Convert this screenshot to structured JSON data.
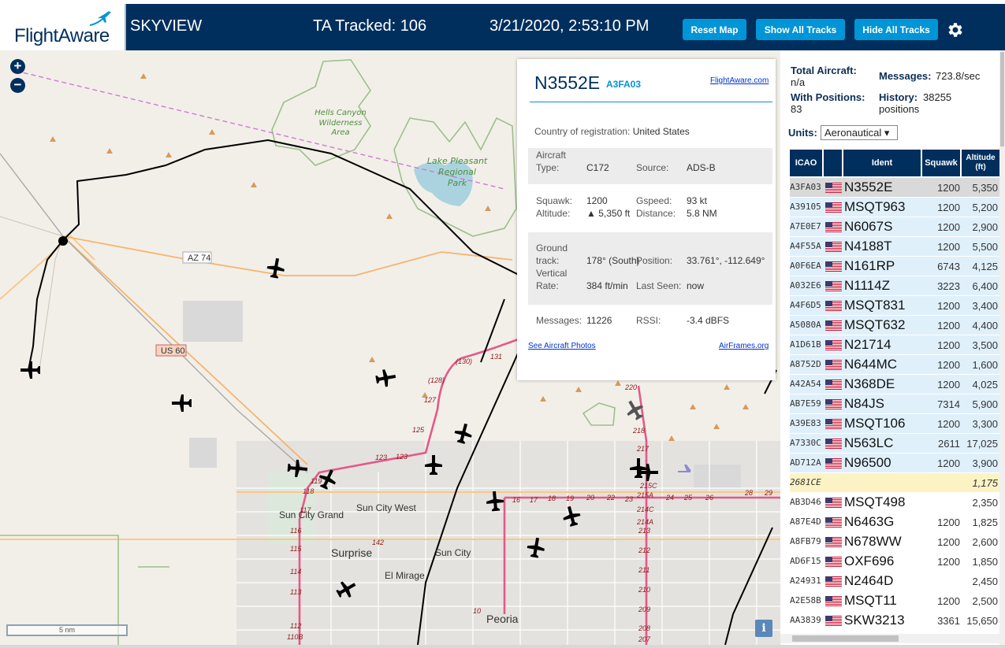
{
  "header": {
    "logo": "FlightAware",
    "title": "SKYVIEW",
    "tracked": "TA Tracked: 106",
    "datetime": "3/21/2020, 2:53:10 PM",
    "buttons": {
      "reset": "Reset Map",
      "show": "Show All Tracks",
      "hide": "Hide All Tracks"
    },
    "settings_icon": "gear-icon"
  },
  "map": {
    "zoom_in": "+",
    "zoom_out": "−",
    "scale": "5 nm",
    "info": "i",
    "labels": {
      "hells_canyon": [
        "Hells Canyon",
        "Wilderness",
        "Area"
      ],
      "lake_pleasant": [
        "Lake Pleasant",
        "Regional",
        "Park"
      ],
      "az74": "AZ 74",
      "us60": "US 60",
      "sun_city_west": "Sun City West",
      "sun_city_grand": "Sun City Grand",
      "sun_city": "Sun City",
      "surprise": "Surprise",
      "el_mirage": "El Mirage",
      "peoria": "Peoria"
    },
    "exit_numbers": [
      "(130)",
      "131",
      "(128)",
      "127",
      "125",
      "123",
      "123",
      "119",
      "118",
      "117",
      "116",
      "115",
      "114",
      "113",
      "112",
      "110B",
      "142",
      "220",
      "218",
      "217",
      "215C",
      "215A",
      "214C",
      "214A",
      "213",
      "212",
      "211",
      "210",
      "209",
      "208",
      "207",
      "16",
      "17",
      "18",
      "19",
      "20",
      "22",
      "23",
      "24",
      "25",
      "26",
      "28",
      "29",
      "10"
    ]
  },
  "detail": {
    "ident": "N3552E",
    "icao": "A3FA03",
    "fa_link": "FlightAware.com",
    "country_label": "Country of registration:",
    "country": "United States",
    "aircraft_type_label": [
      "Aircraft",
      "Type:"
    ],
    "aircraft_type": "C172",
    "source_label": "Source:",
    "source": "ADS-B",
    "squawk_label": "Squawk:",
    "squawk": "1200",
    "gspeed_label": "Gspeed:",
    "gspeed": "93 kt",
    "altitude_label": "Altitude:",
    "altitude": "▲ 5,350 ft",
    "distance_label": "Distance:",
    "distance": "5.8 NM",
    "ground_track_label": [
      "Ground",
      "track:"
    ],
    "ground_track": "178° (South)",
    "position_label": "Position:",
    "position": "33.761°, -112.649°",
    "vrate_label": [
      "Vertical",
      "Rate:"
    ],
    "vrate": "384 ft/min",
    "last_seen_label": "Last Seen:",
    "last_seen": "now",
    "messages_label": "Messages:",
    "messages": "11226",
    "rssi_label": "RSSI:",
    "rssi": "-3.4 dBFS",
    "photos_link": "See Aircraft Photos",
    "airframes_link": "AirFrames.org"
  },
  "sidebar": {
    "total_label": "Total Aircraft:",
    "total": "n/a",
    "messages_label": "Messages:",
    "messages": "723.8/sec",
    "positions_label": "With Positions:",
    "positions": "83",
    "history_label": "History:",
    "history": "38255",
    "history_unit": "positions",
    "units_label": "Units:",
    "units_value": "Aeronautical ▾",
    "columns": {
      "icao": "ICAO",
      "ident": "Ident",
      "squawk": "Squawk",
      "altitude": [
        "Altitude",
        "(ft)"
      ]
    },
    "rows": [
      {
        "icao": "A3FA03",
        "flag": true,
        "ident": "N3552E",
        "squawk": "1200",
        "altitude": "5,350",
        "style": "sel"
      },
      {
        "icao": "A39105",
        "flag": true,
        "ident": "MSQT963",
        "squawk": "1200",
        "altitude": "5,200",
        "style": "blue"
      },
      {
        "icao": "A7E0E7",
        "flag": true,
        "ident": "N6067S",
        "squawk": "1200",
        "altitude": "2,900",
        "style": "blue"
      },
      {
        "icao": "A4F55A",
        "flag": true,
        "ident": "N4188T",
        "squawk": "1200",
        "altitude": "5,500",
        "style": "blue"
      },
      {
        "icao": "A0F6EA",
        "flag": true,
        "ident": "N161RP",
        "squawk": "6743",
        "altitude": "4,125",
        "style": "blue"
      },
      {
        "icao": "A032E6",
        "flag": true,
        "ident": "N1114Z",
        "squawk": "3223",
        "altitude": "6,400",
        "style": "blue"
      },
      {
        "icao": "A4F6D5",
        "flag": true,
        "ident": "MSQT831",
        "squawk": "1200",
        "altitude": "3,400",
        "style": "blue"
      },
      {
        "icao": "A5080A",
        "flag": true,
        "ident": "MSQT632",
        "squawk": "1200",
        "altitude": "4,400",
        "style": "blue"
      },
      {
        "icao": "A1D61B",
        "flag": true,
        "ident": "N21714",
        "squawk": "1200",
        "altitude": "3,500",
        "style": "blue"
      },
      {
        "icao": "A8752D",
        "flag": true,
        "ident": "N644MC",
        "squawk": "1200",
        "altitude": "1,600",
        "style": "blue"
      },
      {
        "icao": "A42A54",
        "flag": true,
        "ident": "N368DE",
        "squawk": "1200",
        "altitude": "4,025",
        "style": "blue"
      },
      {
        "icao": "AB7E59",
        "flag": true,
        "ident": "N84JS",
        "squawk": "7314",
        "altitude": "5,900",
        "style": "blue"
      },
      {
        "icao": "A39E83",
        "flag": true,
        "ident": "MSQT106",
        "squawk": "1200",
        "altitude": "3,300",
        "style": "blue"
      },
      {
        "icao": "A7330C",
        "flag": true,
        "ident": "N563LC",
        "squawk": "2611",
        "altitude": "17,025",
        "style": "blue"
      },
      {
        "icao": "AD712A",
        "flag": true,
        "ident": "N96500",
        "squawk": "1200",
        "altitude": "3,900",
        "style": "blue"
      },
      {
        "icao": "2681CE",
        "flag": false,
        "ident": "",
        "squawk": "",
        "altitude": "1,175",
        "style": "yellow"
      },
      {
        "icao": "AB3D46",
        "flag": true,
        "ident": "MSQT498",
        "squawk": "",
        "altitude": "2,350",
        "style": "white"
      },
      {
        "icao": "A87E4D",
        "flag": true,
        "ident": "N6463G",
        "squawk": "1200",
        "altitude": "1,825",
        "style": "white"
      },
      {
        "icao": "A8FB79",
        "flag": true,
        "ident": "N678WW",
        "squawk": "1200",
        "altitude": "2,600",
        "style": "white"
      },
      {
        "icao": "AD6F15",
        "flag": true,
        "ident": "OXF696",
        "squawk": "1200",
        "altitude": "1,850",
        "style": "white"
      },
      {
        "icao": "A24931",
        "flag": true,
        "ident": "N2464D",
        "squawk": "",
        "altitude": "2,450",
        "style": "white"
      },
      {
        "icao": "A2E58B",
        "flag": true,
        "ident": "MSQT11",
        "squawk": "1200",
        "altitude": "2,500",
        "style": "white"
      },
      {
        "icao": "AA3839",
        "flag": true,
        "ident": "SKW3213",
        "squawk": "3361",
        "altitude": "15,650",
        "style": "white"
      }
    ]
  },
  "colors": {
    "header_bg": "#002f5d",
    "button_bg": "#0095d6",
    "row_blue": "#e0f0fb",
    "row_selected": "#d9d9d9",
    "row_yellow": "#fcf3c5",
    "highway": "#e5588b",
    "map_bg": "#f2efe9"
  }
}
